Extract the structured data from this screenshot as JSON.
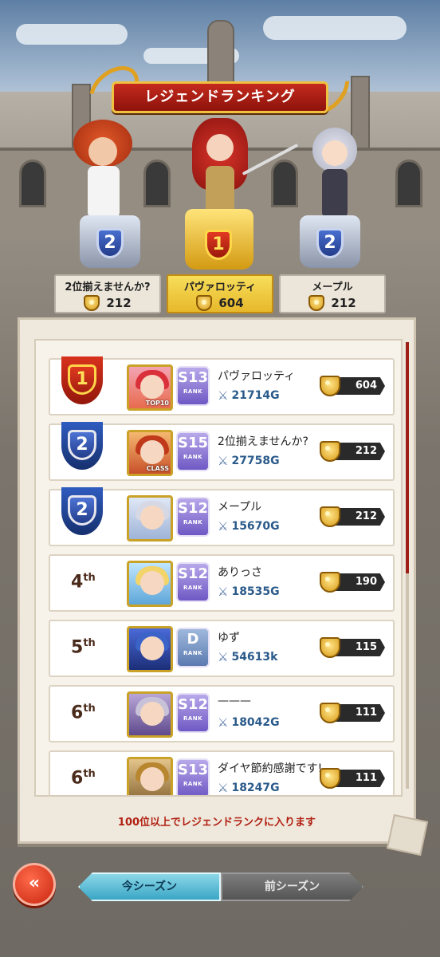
{
  "banner": {
    "title": "レジェンドランキング"
  },
  "podium": [
    {
      "medal": "2",
      "name": "2位揃えませんか?",
      "points": "212",
      "gold": false
    },
    {
      "medal": "1",
      "name": "パヴァロッティ",
      "points": "604",
      "gold": true
    },
    {
      "medal": "2",
      "name": "メープル",
      "points": "212",
      "gold": false
    }
  ],
  "rows": [
    {
      "rank": "1",
      "rank_style": "red-medal",
      "avatar_tag": "TOP10",
      "badge_main": "S13",
      "badge_sub": "RANK",
      "badge_num": "8",
      "name": "パヴァロッティ",
      "power": "21714G",
      "points": "604"
    },
    {
      "rank": "2",
      "rank_style": "blue-medal",
      "avatar_tag": "CLASS",
      "badge_main": "S15",
      "badge_sub": "RANK",
      "badge_num": "1",
      "name": "2位揃えませんか?",
      "power": "27758G",
      "points": "212"
    },
    {
      "rank": "2",
      "rank_style": "blue-medal",
      "avatar_tag": "",
      "badge_main": "S12",
      "badge_sub": "RANK",
      "badge_num": "3",
      "name": "メープル",
      "power": "15670G",
      "points": "212"
    },
    {
      "rank": "4",
      "rank_suffix": "th",
      "rank_style": "text",
      "avatar_tag": "",
      "badge_main": "S12",
      "badge_sub": "RANK",
      "badge_num": "10",
      "name": "ありっさ",
      "power": "18535G",
      "points": "190"
    },
    {
      "rank": "5",
      "rank_suffix": "th",
      "rank_style": "text",
      "avatar_tag": "",
      "badge_main": "D",
      "badge_sub": "RANK",
      "badge_num": "1",
      "name": "ゆず",
      "power": "54613k",
      "points": "115"
    },
    {
      "rank": "6",
      "rank_suffix": "th",
      "rank_style": "text",
      "avatar_tag": "",
      "badge_main": "S12",
      "badge_sub": "RANK",
      "badge_num": "9",
      "name": "———",
      "power": "18042G",
      "points": "111"
    },
    {
      "rank": "6",
      "rank_suffix": "th",
      "rank_style": "text",
      "avatar_tag": "",
      "badge_main": "S13",
      "badge_sub": "RANK",
      "badge_num": "2",
      "name": "ダイヤ節約感謝です!",
      "power": "18247G",
      "points": "111"
    }
  ],
  "note": "100位以上でレジェンドランクに入ります",
  "tabs": {
    "current": "今シーズン",
    "previous": "前シーズン"
  },
  "back_button": "«",
  "colors": {
    "accent_red": "#9c2016",
    "gold": "#e7b82b",
    "tab_active": "#3aa6c6"
  }
}
